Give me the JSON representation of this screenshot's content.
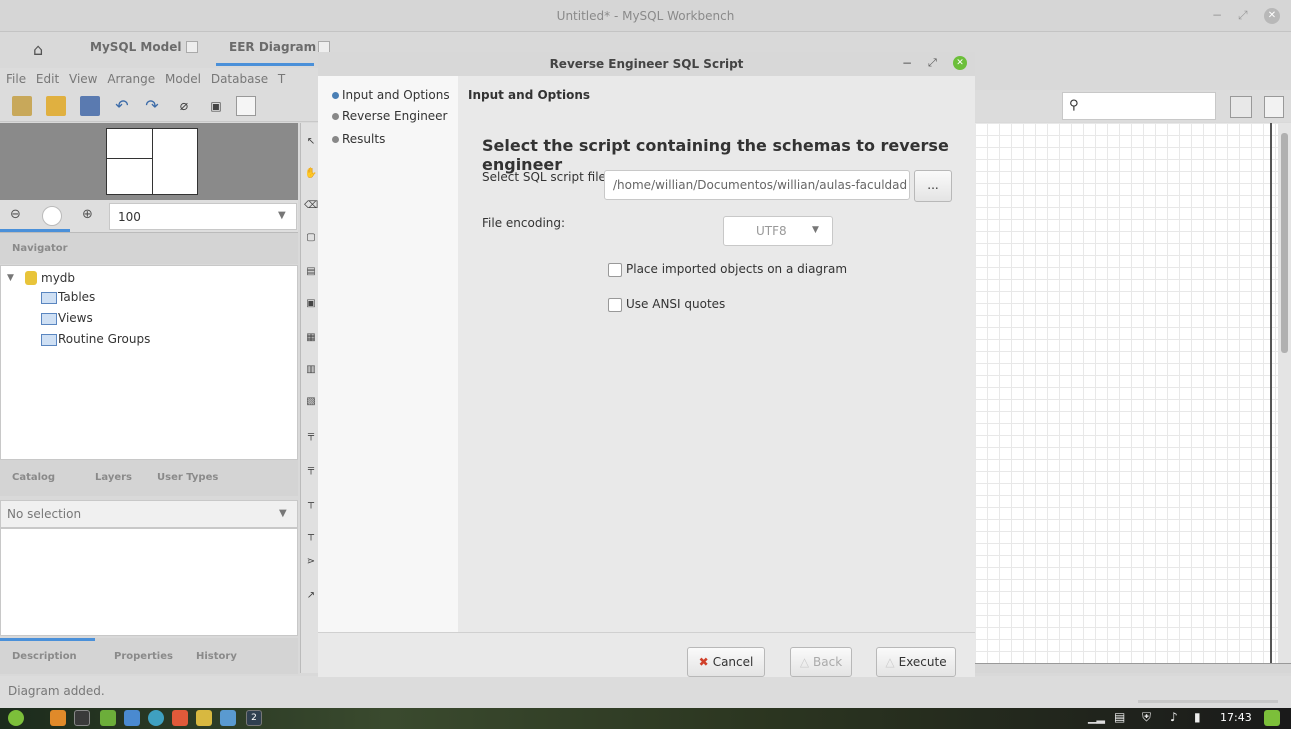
{
  "window": {
    "title": "Untitled* - MySQL Workbench"
  },
  "tabs": [
    {
      "label": "MySQL Model"
    },
    {
      "label": "EER Diagram"
    }
  ],
  "menu": [
    "File",
    "Edit",
    "View",
    "Arrange",
    "Model",
    "Database",
    "T"
  ],
  "zoom": {
    "value": "100"
  },
  "navigator": {
    "label": "Navigator"
  },
  "catalog": {
    "schema": "mydb",
    "items": [
      "Tables",
      "Views",
      "Routine Groups"
    ]
  },
  "catalog_tabs": [
    "Catalog",
    "Layers",
    "User Types"
  ],
  "selection": {
    "value": "No selection"
  },
  "description_tabs": [
    "Description",
    "Properties",
    "History"
  ],
  "status": {
    "text": "Diagram added."
  },
  "dialog": {
    "title": "Reverse Engineer SQL Script",
    "steps": [
      "Input and Options",
      "Reverse Engineer",
      "Results"
    ],
    "section_title": "Input and Options",
    "heading": "Select the script containing the schemas to reverse engineer",
    "file_label": "Select SQL script file:",
    "file_value": "/home/willian/Documentos/willian/aulas-faculdad",
    "browse_label": "...",
    "encoding_label": "File encoding:",
    "encoding_value": "UTF8",
    "place_label": "Place imported objects on a diagram",
    "ansi_label": "Use ANSI quotes",
    "cancel": "Cancel",
    "back": "Back",
    "execute": "Execute"
  },
  "taskbar": {
    "clock": "17:43",
    "badge": "2"
  },
  "colors": {
    "accent": "#4a90d9",
    "cancel_icon": "#d0402a",
    "taskbar_dark": "#1c2b1c"
  }
}
